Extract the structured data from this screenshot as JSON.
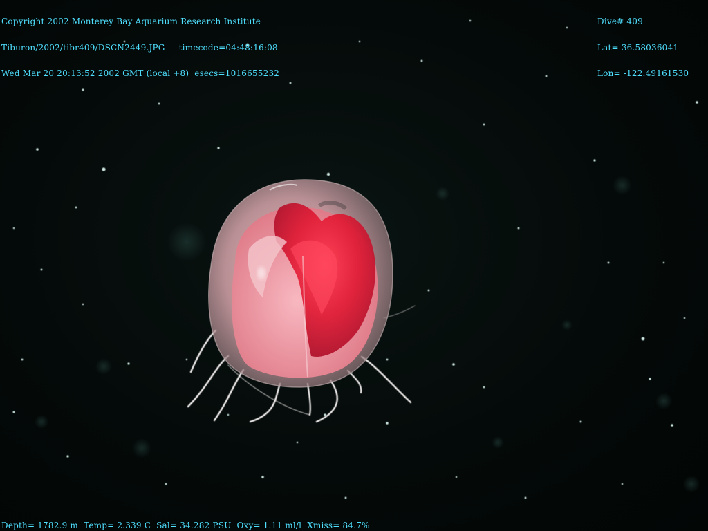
{
  "overlay": {
    "top_left": {
      "line1": "Copyright 2002 Monterey Bay Aquarium Research Institute",
      "line2_path": "Tiburon/2002/tibr409/DSCN2449.JPG",
      "line2_timecode": "timecode=04:48:16:08",
      "line3_date": "Wed Mar 20 20:13:52 2002 GMT (local +8)",
      "line3_esecs": "esecs=1016655232"
    },
    "top_right": {
      "dive": "Dive# 409",
      "lat": "Lat= 36.58036041",
      "lon": "Lon= -122.49161530"
    },
    "bottom_left": {
      "depth": "Depth= 1782.9 m",
      "temp": "Temp= 2.339 C",
      "sal": "Sal= 34.282 PSU",
      "oxy": "Oxy= 1.11 ml/l",
      "xmiss": "Xmiss= 84.7%"
    }
  },
  "colors": {
    "overlay_text": "#4fe0ff",
    "background": "#030807",
    "bell_red": "#e0203a",
    "bell_pink": "#f0a0a8"
  }
}
